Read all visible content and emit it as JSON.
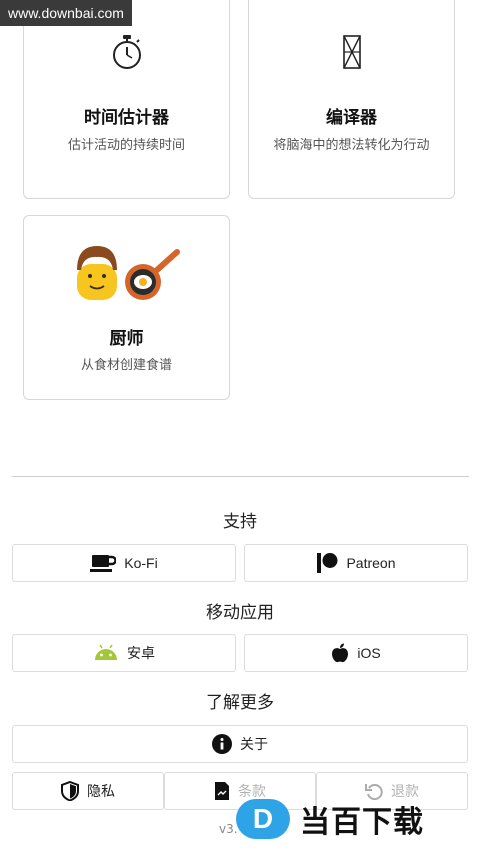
{
  "watermark": {
    "site": "www.downbai.com",
    "logo_text": "当百下载",
    "logo_letter": "D"
  },
  "cards": [
    {
      "title": "时间估计器",
      "desc": "估计活动的持续时间",
      "icon": "stopwatch-icon"
    },
    {
      "title": "编译器",
      "desc": "将脑海中的想法转化为行动",
      "icon": "hourglass-icon"
    },
    {
      "title": "厨师",
      "desc": "从食材创建食谱",
      "icon": "chef-frying-pan-icon"
    }
  ],
  "support": {
    "title": "支持",
    "kofi": "Ko-Fi",
    "patreon": "Patreon"
  },
  "mobile": {
    "title": "移动应用",
    "android": "安卓",
    "ios": "iOS"
  },
  "learn_more": {
    "title": "了解更多",
    "about": "关于",
    "privacy": "隐私",
    "terms": "条款",
    "refund": "退款"
  },
  "version": "v3.",
  "colors": {
    "android_green": "#a4c639",
    "logo_blue": "#2ea3e6",
    "pan_orange": "#d4662b"
  }
}
